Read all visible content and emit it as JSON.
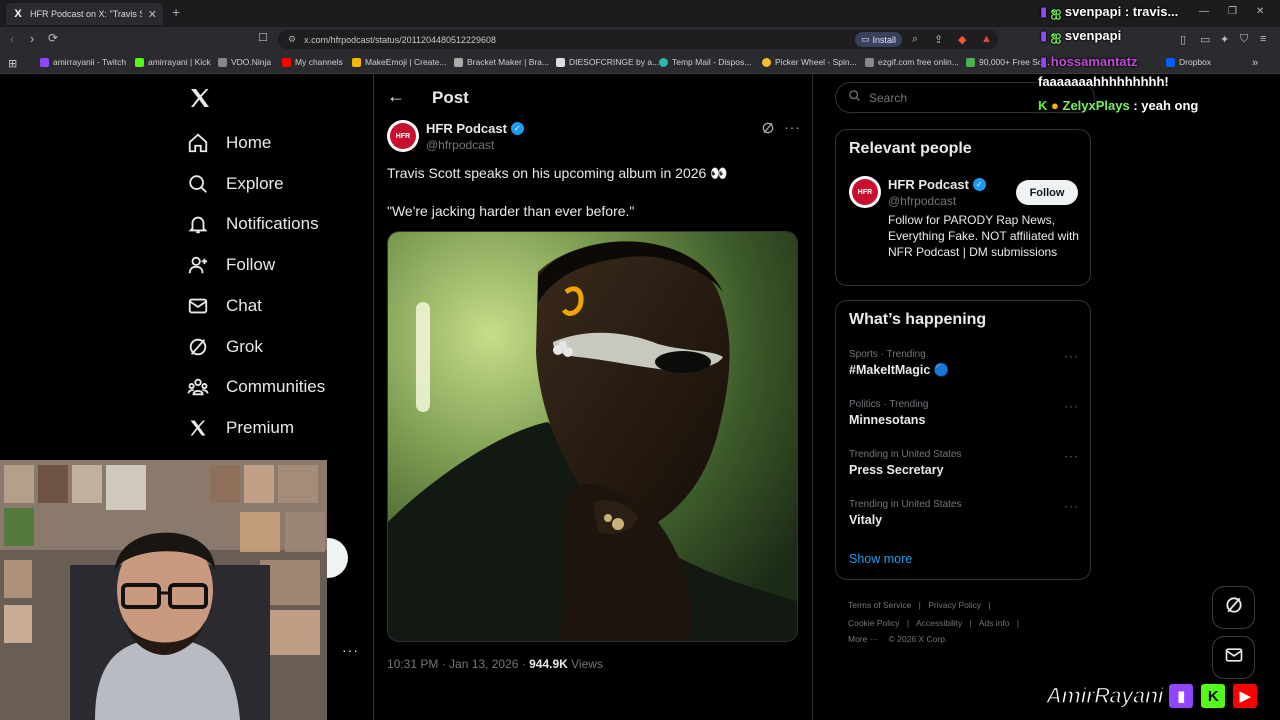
{
  "browser": {
    "tab_title": "HFR Podcast on X: \"Travis Scott s",
    "tab_favicon": "X",
    "new_tab": "+",
    "url": "x.com/hfrpodcast/status/2011204480512229608",
    "install_label": "Install",
    "bookmarks": [
      {
        "label": "amirrayanii - Twitch",
        "color": "#9146ff"
      },
      {
        "label": "amirrayani | Kick",
        "color": "#53fc18"
      },
      {
        "label": "VDO.Ninja",
        "color": "#888888"
      },
      {
        "label": "My channels",
        "color": "#ff0000"
      },
      {
        "label": "MakeEmoji | Create...",
        "color": "#f5b800"
      },
      {
        "label": "Bracket Maker | Bra...",
        "color": "#aaaaaa"
      },
      {
        "label": "DIESOFCRINGE by a...",
        "color": "#dddddd"
      },
      {
        "label": "Temp Mail - Dispos...",
        "color": "#2bb6a8"
      },
      {
        "label": "Picker Wheel - Spin...",
        "color": "#f2c12e"
      },
      {
        "label": "ezgif.com free onlin...",
        "color": "#888888"
      },
      {
        "label": "90,000+ Free So...",
        "color": "#4caf50"
      },
      {
        "label": "Dropbox",
        "color": "#0061ff"
      }
    ]
  },
  "nav": {
    "items": [
      {
        "label": "Home",
        "icon": "home-icon"
      },
      {
        "label": "Explore",
        "icon": "search-icon"
      },
      {
        "label": "Notifications",
        "icon": "bell-icon"
      },
      {
        "label": "Follow",
        "icon": "person-add-icon"
      },
      {
        "label": "Chat",
        "icon": "mail-icon"
      },
      {
        "label": "Grok",
        "icon": "grok-icon"
      },
      {
        "label": "Communities",
        "icon": "communities-icon"
      },
      {
        "label": "Premium",
        "icon": "x-logo-icon"
      }
    ]
  },
  "post": {
    "header_title": "Post",
    "author_name": "HFR Podcast",
    "author_handle": "@hfrpodcast",
    "avatar_text": "HFR",
    "text_line1": "Travis Scott speaks on his upcoming album in 2026 👀",
    "text_line2": "\"We're jacking harder than ever before.\"",
    "timestamp": "10:31 PM · Jan 13, 2026 · ",
    "views_count": "944.9K",
    "views_label": " Views"
  },
  "sidebar": {
    "search_placeholder": "Search",
    "relevant_title": "Relevant people",
    "relevant_person": {
      "name": "HFR Podcast",
      "handle": "@hfrpodcast",
      "bio": "Follow for PARODY Rap News, Everything Fake. NOT affiliated with NFR Podcast | DM submissions",
      "follow_label": "Follow"
    },
    "happening_title": "What’s happening",
    "trends": [
      {
        "meta": "Sports · Trending",
        "name": "#MakeItMagic 🔵"
      },
      {
        "meta": "Politics · Trending",
        "name": "Minnesotans"
      },
      {
        "meta": "Trending in United States",
        "name": "Press Secretary"
      },
      {
        "meta": "Trending in United States",
        "name": "Vitaly"
      }
    ],
    "show_more": "Show more",
    "footer_row1": [
      "Terms of Service",
      "|",
      "Privacy Policy",
      "|"
    ],
    "footer_row2": [
      "Cookie Policy",
      "|",
      "Accessibility",
      "|",
      "Ads info",
      "|"
    ],
    "footer_row3": [
      "More ···",
      "© 2026 X Corp."
    ]
  },
  "stream": {
    "chat": [
      {
        "user": "svenpapi",
        "message": " : travis...",
        "color": "#ffffff"
      },
      {
        "user": "svenpapi",
        "message": "",
        "color": "#ffffff"
      },
      {
        "user": "hossamantatz",
        "message": "",
        "color": "#c04bd8"
      },
      {
        "user": "",
        "message": "faaaaaaahhhhhhhhh!",
        "color": "#ffffff"
      },
      {
        "user": "ZelyxPlays",
        "message": " : yeah ong",
        "color": "#7cf05a"
      }
    ],
    "streamer_name": "AmirRayani"
  },
  "colors": {
    "accent": "#1d9bf0",
    "background": "#000000",
    "border": "#2f3336",
    "muted": "#71767b"
  }
}
